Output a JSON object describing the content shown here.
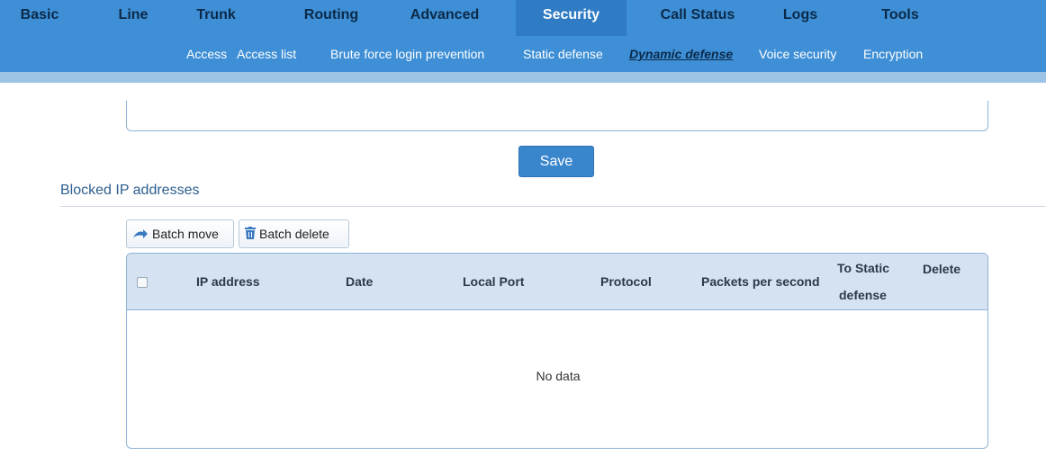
{
  "nav": {
    "tabs": [
      "Basic",
      "Line",
      "Trunk",
      "Routing",
      "Advanced",
      "Security",
      "Call Status",
      "Logs",
      "Tools"
    ],
    "active_tab": "Security"
  },
  "subnav": {
    "items": [
      "Access",
      "Access list",
      "Brute force login prevention",
      "Static defense",
      "Dynamic defense",
      "Voice security",
      "Encryption"
    ],
    "active_item": "Dynamic defense"
  },
  "actions": {
    "save_label": "Save"
  },
  "blocked": {
    "title": "Blocked IP addresses",
    "batch_move_label": "Batch move",
    "batch_delete_label": "Batch delete",
    "columns": {
      "ip": "IP address",
      "date": "Date",
      "local_port": "Local Port",
      "protocol": "Protocol",
      "pps": "Packets per second",
      "to_static_1": "To Static",
      "to_static_2": "defense",
      "delete": "Delete"
    },
    "empty_text": "No data"
  },
  "colors": {
    "nav_bg": "#3e8fd5",
    "nav_active_bg": "#2f7bc4",
    "button_bg": "#3a86cc",
    "table_header_bg": "#d4e2f1"
  }
}
